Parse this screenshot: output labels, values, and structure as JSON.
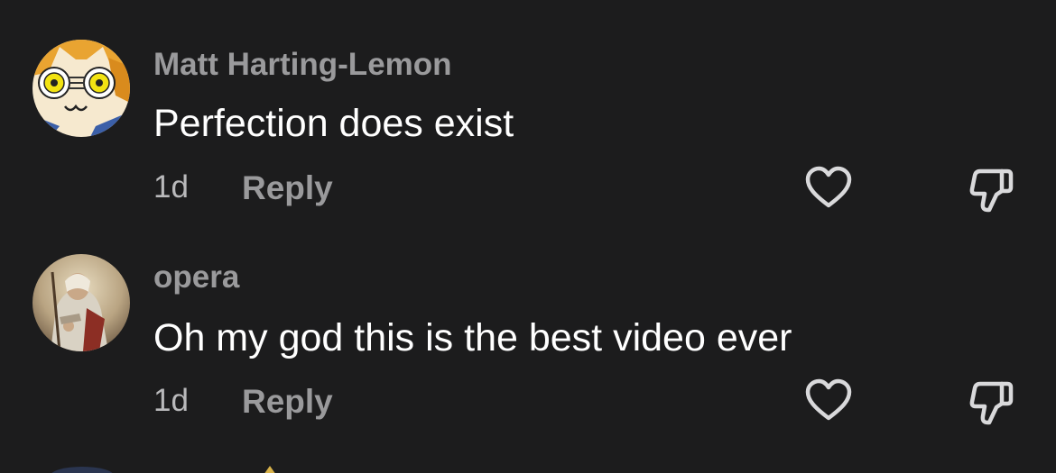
{
  "comments": [
    {
      "username": "Matt Harting-Lemon",
      "text": "Perfection does exist",
      "age": "1d",
      "reply_label": "Reply",
      "avatar_icon": "cartoon-cat-avatar",
      "like_icon": "heart-outline-icon",
      "dislike_icon": "thumbs-down-outline-icon"
    },
    {
      "username": "opera",
      "text": "Oh my god this is the best video ever",
      "age": "1d",
      "reply_label": "Reply",
      "avatar_icon": "painting-portrait-avatar",
      "like_icon": "heart-outline-icon",
      "dislike_icon": "thumbs-down-outline-icon"
    }
  ],
  "colors": {
    "background": "#1c1c1d",
    "username": "#9a9a9c",
    "comment_text": "#ffffff",
    "icon_stroke": "#d9d9db"
  }
}
